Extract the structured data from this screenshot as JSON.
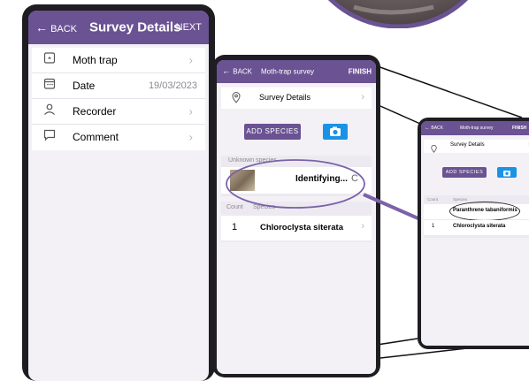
{
  "colors": {
    "header": "#6a5293",
    "camera_button": "#1a93e6",
    "screen_bg": "#f3f1f6",
    "callout": "#7b62a8"
  },
  "phone1": {
    "header": {
      "back": "BACK",
      "title": "Survey Details",
      "next": "NEXT"
    },
    "rows": [
      {
        "icon": "moth-trap-icon",
        "label": "Moth trap",
        "value": ""
      },
      {
        "icon": "calendar-icon",
        "label": "Date",
        "value": "19/03/2023"
      },
      {
        "icon": "person-icon",
        "label": "Recorder",
        "value": ""
      },
      {
        "icon": "comment-icon",
        "label": "Comment",
        "value": ""
      }
    ]
  },
  "phone2": {
    "header": {
      "back": "BACK",
      "title": "Moth-trap survey",
      "finish": "FINISH"
    },
    "survey_details": "Survey Details",
    "add_species": "ADD SPECIES",
    "unknown_heading": "Unknown species",
    "identifying": "Identifying...",
    "table_headers": {
      "count": "Count",
      "species": "Species"
    },
    "species_rows": [
      {
        "count": "1",
        "name": "Chloroclysta siterata"
      }
    ]
  },
  "phone3": {
    "header": {
      "back": "BACK",
      "title": "Moth-trap survey",
      "finish": "FINISH"
    },
    "survey_details": "Survey Details",
    "add_species": "ADD SPECIES",
    "table_headers": {
      "count": "Count",
      "species": "Species"
    },
    "species_rows": [
      {
        "count": "",
        "name": "Paranthrene tabaniformis"
      },
      {
        "count": "1",
        "name": "Chloroclysta siterata"
      }
    ]
  }
}
